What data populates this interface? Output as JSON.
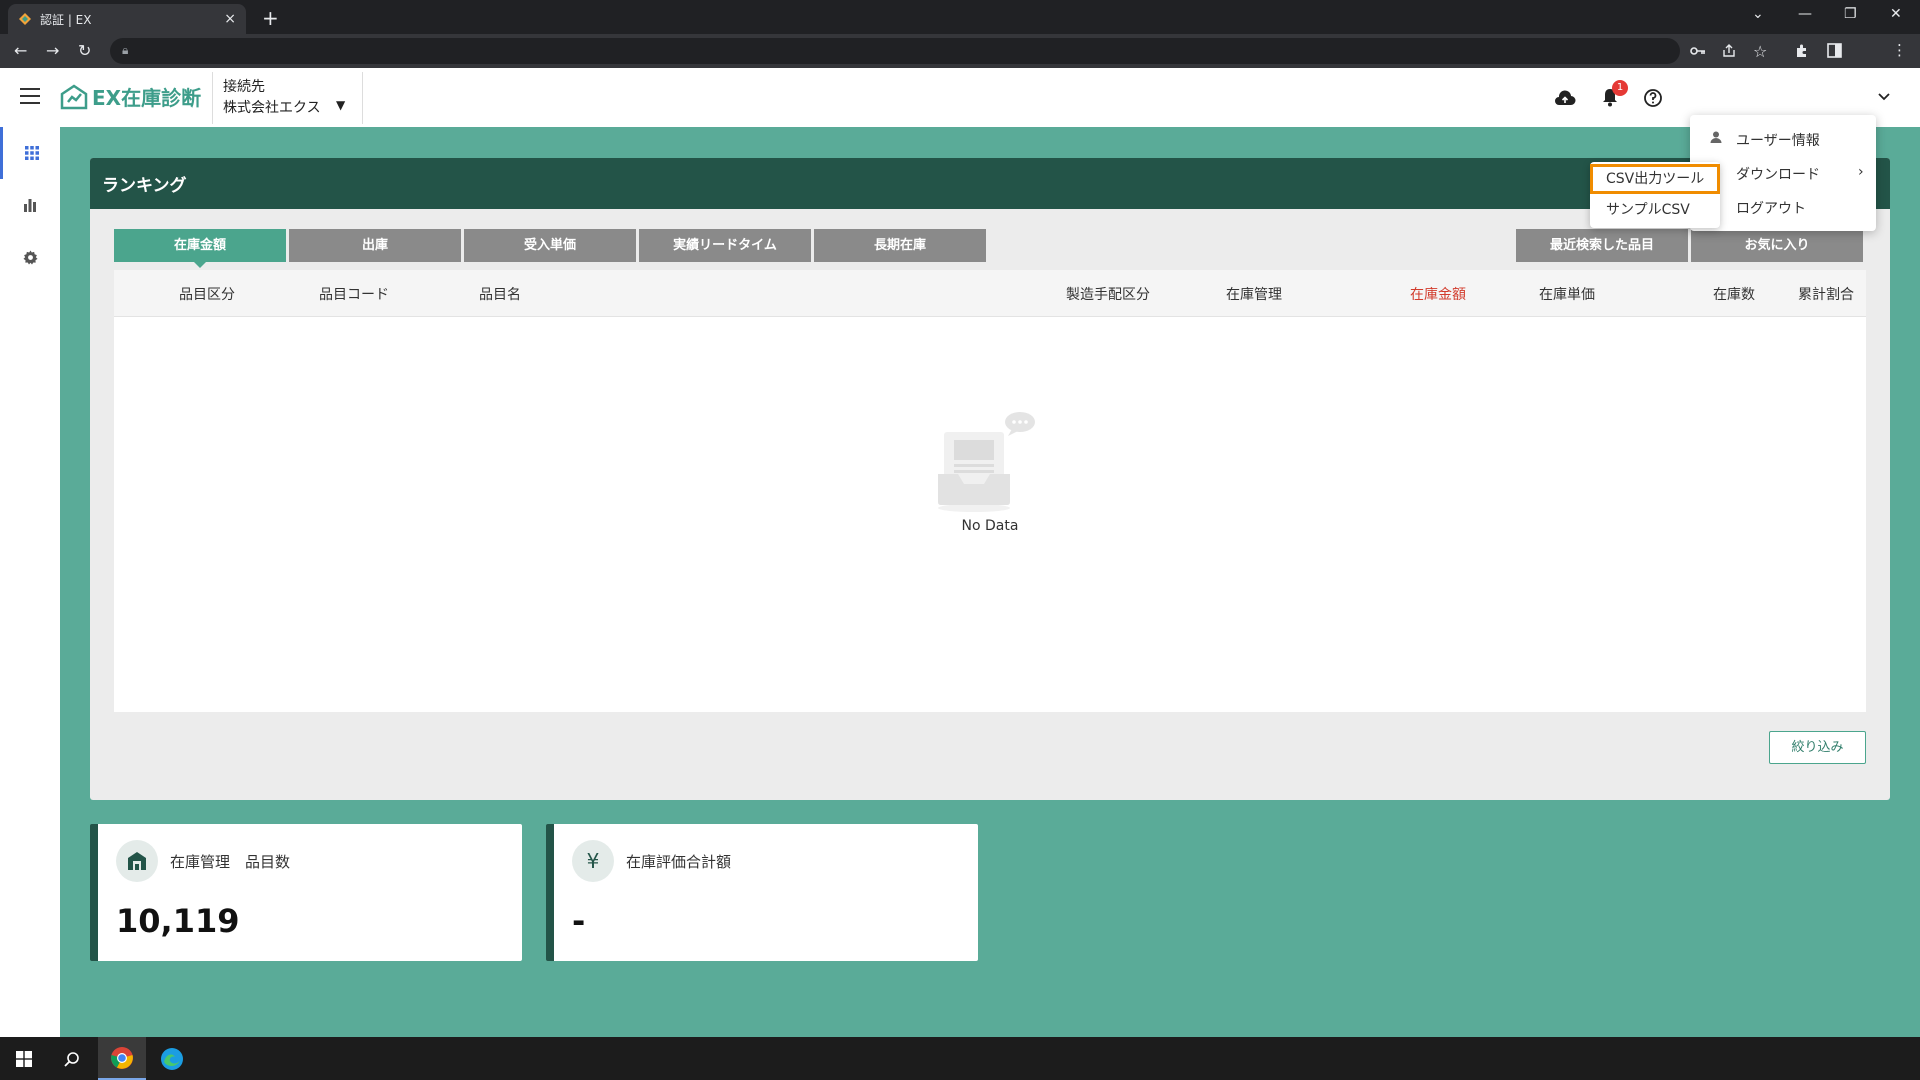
{
  "browser": {
    "tab_title": "認証 | EX",
    "tab_close": "×",
    "new_tab": "+",
    "window_controls": {
      "minimize": "—",
      "restore": "❐",
      "close": "✕",
      "tab_search": "⌄"
    }
  },
  "header": {
    "logo_text": "EX在庫診断",
    "connection_label": "接続先",
    "connection_value": "株式会社エクス",
    "dropdown_arrow": "▼",
    "notification_count": "1"
  },
  "menu": {
    "items": [
      {
        "label": "ユーザー情報"
      },
      {
        "label": "ダウンロード"
      },
      {
        "label": "ログアウト"
      }
    ],
    "submenu": [
      {
        "label": "CSV出力ツール"
      },
      {
        "label": "サンプルCSV"
      }
    ]
  },
  "ranking": {
    "title": "ランキング",
    "tabs": [
      {
        "label": "在庫金額"
      },
      {
        "label": "出庫"
      },
      {
        "label": "受入単価"
      },
      {
        "label": "実績リードタイム"
      },
      {
        "label": "長期在庫"
      }
    ],
    "right_tabs": [
      {
        "label": "最近検索した品目"
      },
      {
        "label": "お気に入り"
      }
    ],
    "columns": [
      {
        "label": "品目区分"
      },
      {
        "label": "品目コード"
      },
      {
        "label": "品目名"
      },
      {
        "label": "製造手配区分"
      },
      {
        "label": "在庫管理"
      },
      {
        "label": "在庫金額"
      },
      {
        "label": "在庫単価"
      },
      {
        "label": "在庫数"
      },
      {
        "label": "累計割合"
      }
    ],
    "empty_text": "No Data",
    "filter_button": "絞り込み"
  },
  "stats": [
    {
      "label": "在庫管理　品目数",
      "value": "10,119"
    },
    {
      "label": "在庫評価合計額",
      "value": "-",
      "icon": "¥"
    }
  ],
  "colors": {
    "background": "#5aab98",
    "header_dark": "#235448",
    "tab_active": "#4ba58d",
    "tab_inactive": "#8a8a8a",
    "sorted_column": "#d23b2c",
    "highlight": "#f08c00",
    "badge": "#e53935"
  }
}
